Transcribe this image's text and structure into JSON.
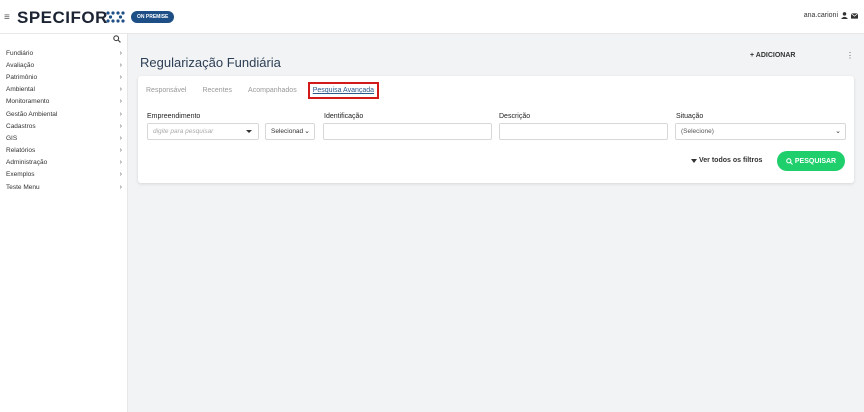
{
  "header": {
    "logo_text": "SPECIFOR",
    "badge": "ON PREMISE",
    "user": "ana.carioni",
    "brand_color": "#1d4f86"
  },
  "sidebar": {
    "items": [
      {
        "label": "Fundiário"
      },
      {
        "label": "Avaliação"
      },
      {
        "label": "Patrimônio"
      },
      {
        "label": "Ambiental"
      },
      {
        "label": "Monitoramento"
      },
      {
        "label": "Gestão Ambiental"
      },
      {
        "label": "Cadastros"
      },
      {
        "label": "GIS"
      },
      {
        "label": "Relatórios"
      },
      {
        "label": "Administração"
      },
      {
        "label": "Exemplos"
      },
      {
        "label": "Teste Menu"
      }
    ],
    "chevron": "›"
  },
  "main": {
    "title": "Regularização Fundiária",
    "add_label": "+ ADICIONAR",
    "kebab": "⋮",
    "tabs": [
      {
        "label": "Responsável"
      },
      {
        "label": "Recentes"
      },
      {
        "label": "Acompanhados"
      },
      {
        "label": "Pesquisa Avançada"
      }
    ],
    "active_tab": "Pesquisa Avançada",
    "form": {
      "empreendimento_label": "Empreendimento",
      "empreendimento_placeholder": "digite para pesquisar",
      "empreendimento_select": "Selecionad",
      "identificacao_label": "Identificação",
      "identificacao_value": "",
      "descricao_label": "Descrição",
      "descricao_value": "",
      "situacao_label": "Situação",
      "situacao_value": "(Selecione)"
    },
    "filters_link": "Ver todos os filtros",
    "search_button": "PESQUISAR",
    "search_color": "#1fcf6c"
  }
}
